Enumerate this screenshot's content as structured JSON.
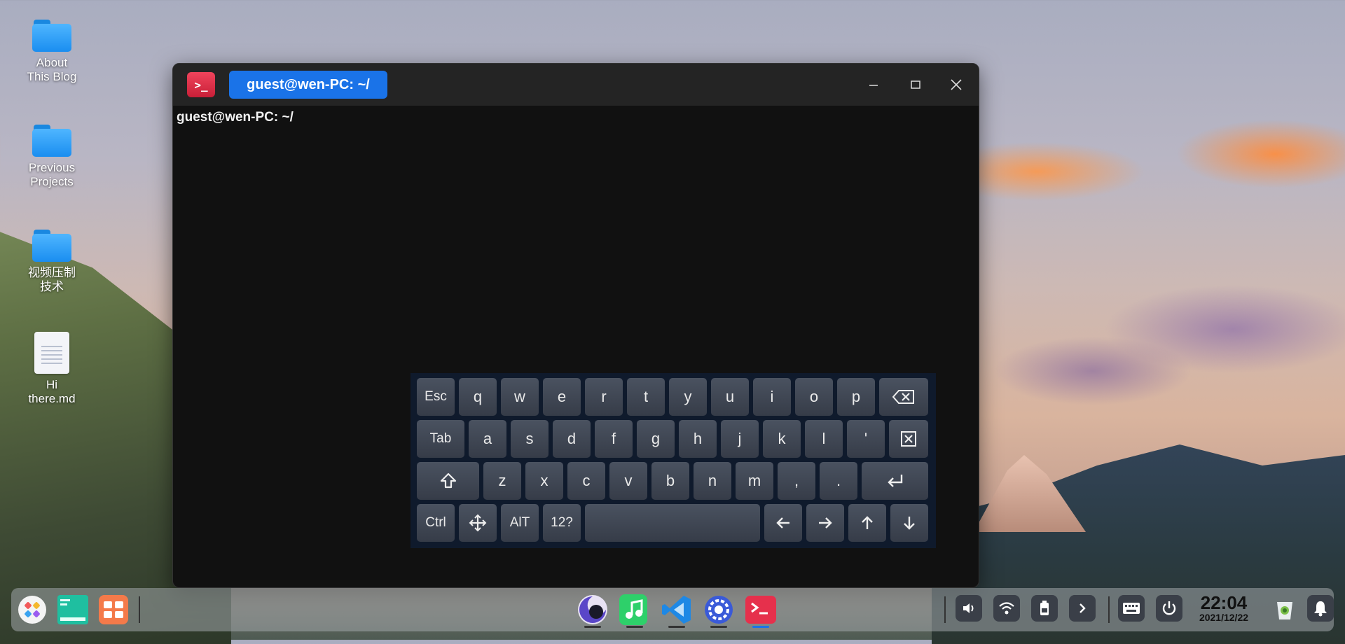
{
  "desktop": {
    "icons": [
      {
        "label_line1": "About",
        "label_line2": "This Blog",
        "type": "folder"
      },
      {
        "label_line1": "Previous",
        "label_line2": "Projects",
        "type": "folder"
      },
      {
        "label_line1": "视频压制",
        "label_line2": "技术",
        "type": "folder"
      },
      {
        "label_line1": "Hi",
        "label_line2": "there.md",
        "type": "document"
      }
    ]
  },
  "window": {
    "app_icon": "terminal-icon",
    "tab_title": "guest@wen-PC: ~/",
    "prompt": "guest@wen-PC: ~/"
  },
  "keyboard": {
    "row1": [
      "Esc",
      "q",
      "w",
      "e",
      "r",
      "t",
      "y",
      "u",
      "i",
      "o",
      "p"
    ],
    "row2": [
      "Tab",
      "a",
      "s",
      "d",
      "f",
      "g",
      "h",
      "j",
      "k",
      "l",
      "'"
    ],
    "row3": [
      "z",
      "x",
      "c",
      "v",
      "b",
      "n",
      "m",
      ",",
      "."
    ],
    "row4": [
      "Ctrl",
      "AlT",
      "12?"
    ]
  },
  "taskbar": {
    "clock_time": "22:04",
    "clock_date": "2021/12/22",
    "apps": [
      "launcher-icon",
      "files-icon",
      "app-grid-icon"
    ],
    "dock": [
      "browser-icon",
      "music-icon",
      "vscode-icon",
      "settings-icon",
      "terminal-icon"
    ],
    "tray": [
      "volume-icon",
      "wifi-icon",
      "battery-icon",
      "chevron-right-icon",
      "keyboard-icon",
      "power-icon",
      "trash-icon",
      "bell-icon"
    ]
  },
  "colors": {
    "accent": "#1a73e8",
    "terminal_bg": "#111111",
    "keyboard_bg": "#0f1a2c"
  }
}
